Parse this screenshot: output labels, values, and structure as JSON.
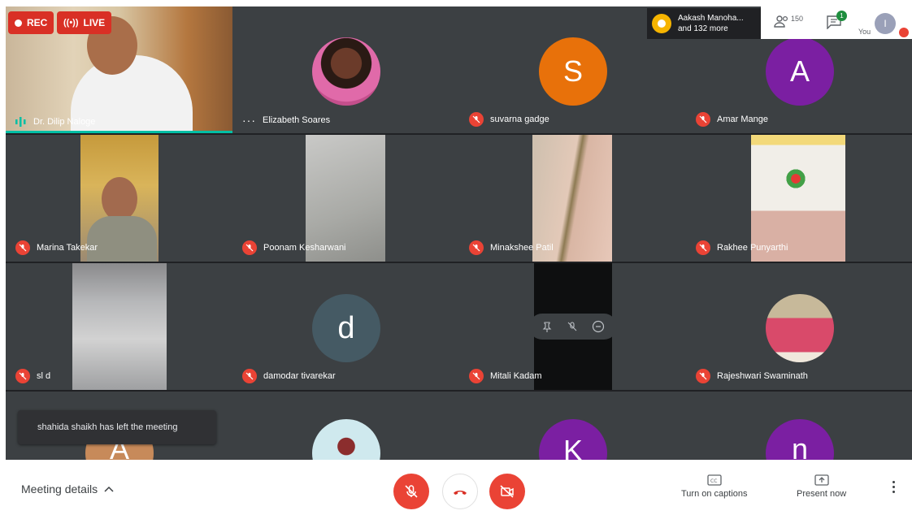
{
  "top": {
    "rec_label": "REC",
    "live_label": "LIVE",
    "viewer_line1": "Aakash Manoha...",
    "viewer_line2": "and 132 more",
    "people_count": "150",
    "chat_badge": "1",
    "self_label": "You",
    "self_initial": "I"
  },
  "tiles": {
    "t1": "Dr. Dilip Naloge",
    "t2": "Elizabeth Soares",
    "t3": "suvarna gadge",
    "t4": "Amar Mange",
    "t5": "Marina Takekar",
    "t6": "Poonam Kesharwani",
    "t7": "Minakshee Patil",
    "t8": "Rakhee Punyarthi",
    "t9": "sl d",
    "t10": "damodar tivarekar",
    "t11": "Mitali Kadam",
    "t12": "Rajeshwari Swaminath"
  },
  "avatars": {
    "a3": "S",
    "a4": "A",
    "a10": "d",
    "a13": "A",
    "a15": "K",
    "a16": "n"
  },
  "toast": "shahida shaikh has left the meeting",
  "bottom": {
    "meeting_details": "Meeting details",
    "captions": "Turn on captions",
    "present": "Present now"
  },
  "colors": {
    "stage": "#202124",
    "tile": "#3c4043",
    "red": "#ea4335",
    "orange": "#e8710a",
    "purple": "#7b1fa2",
    "slate": "#455a64",
    "accent": "#00bfa5"
  }
}
